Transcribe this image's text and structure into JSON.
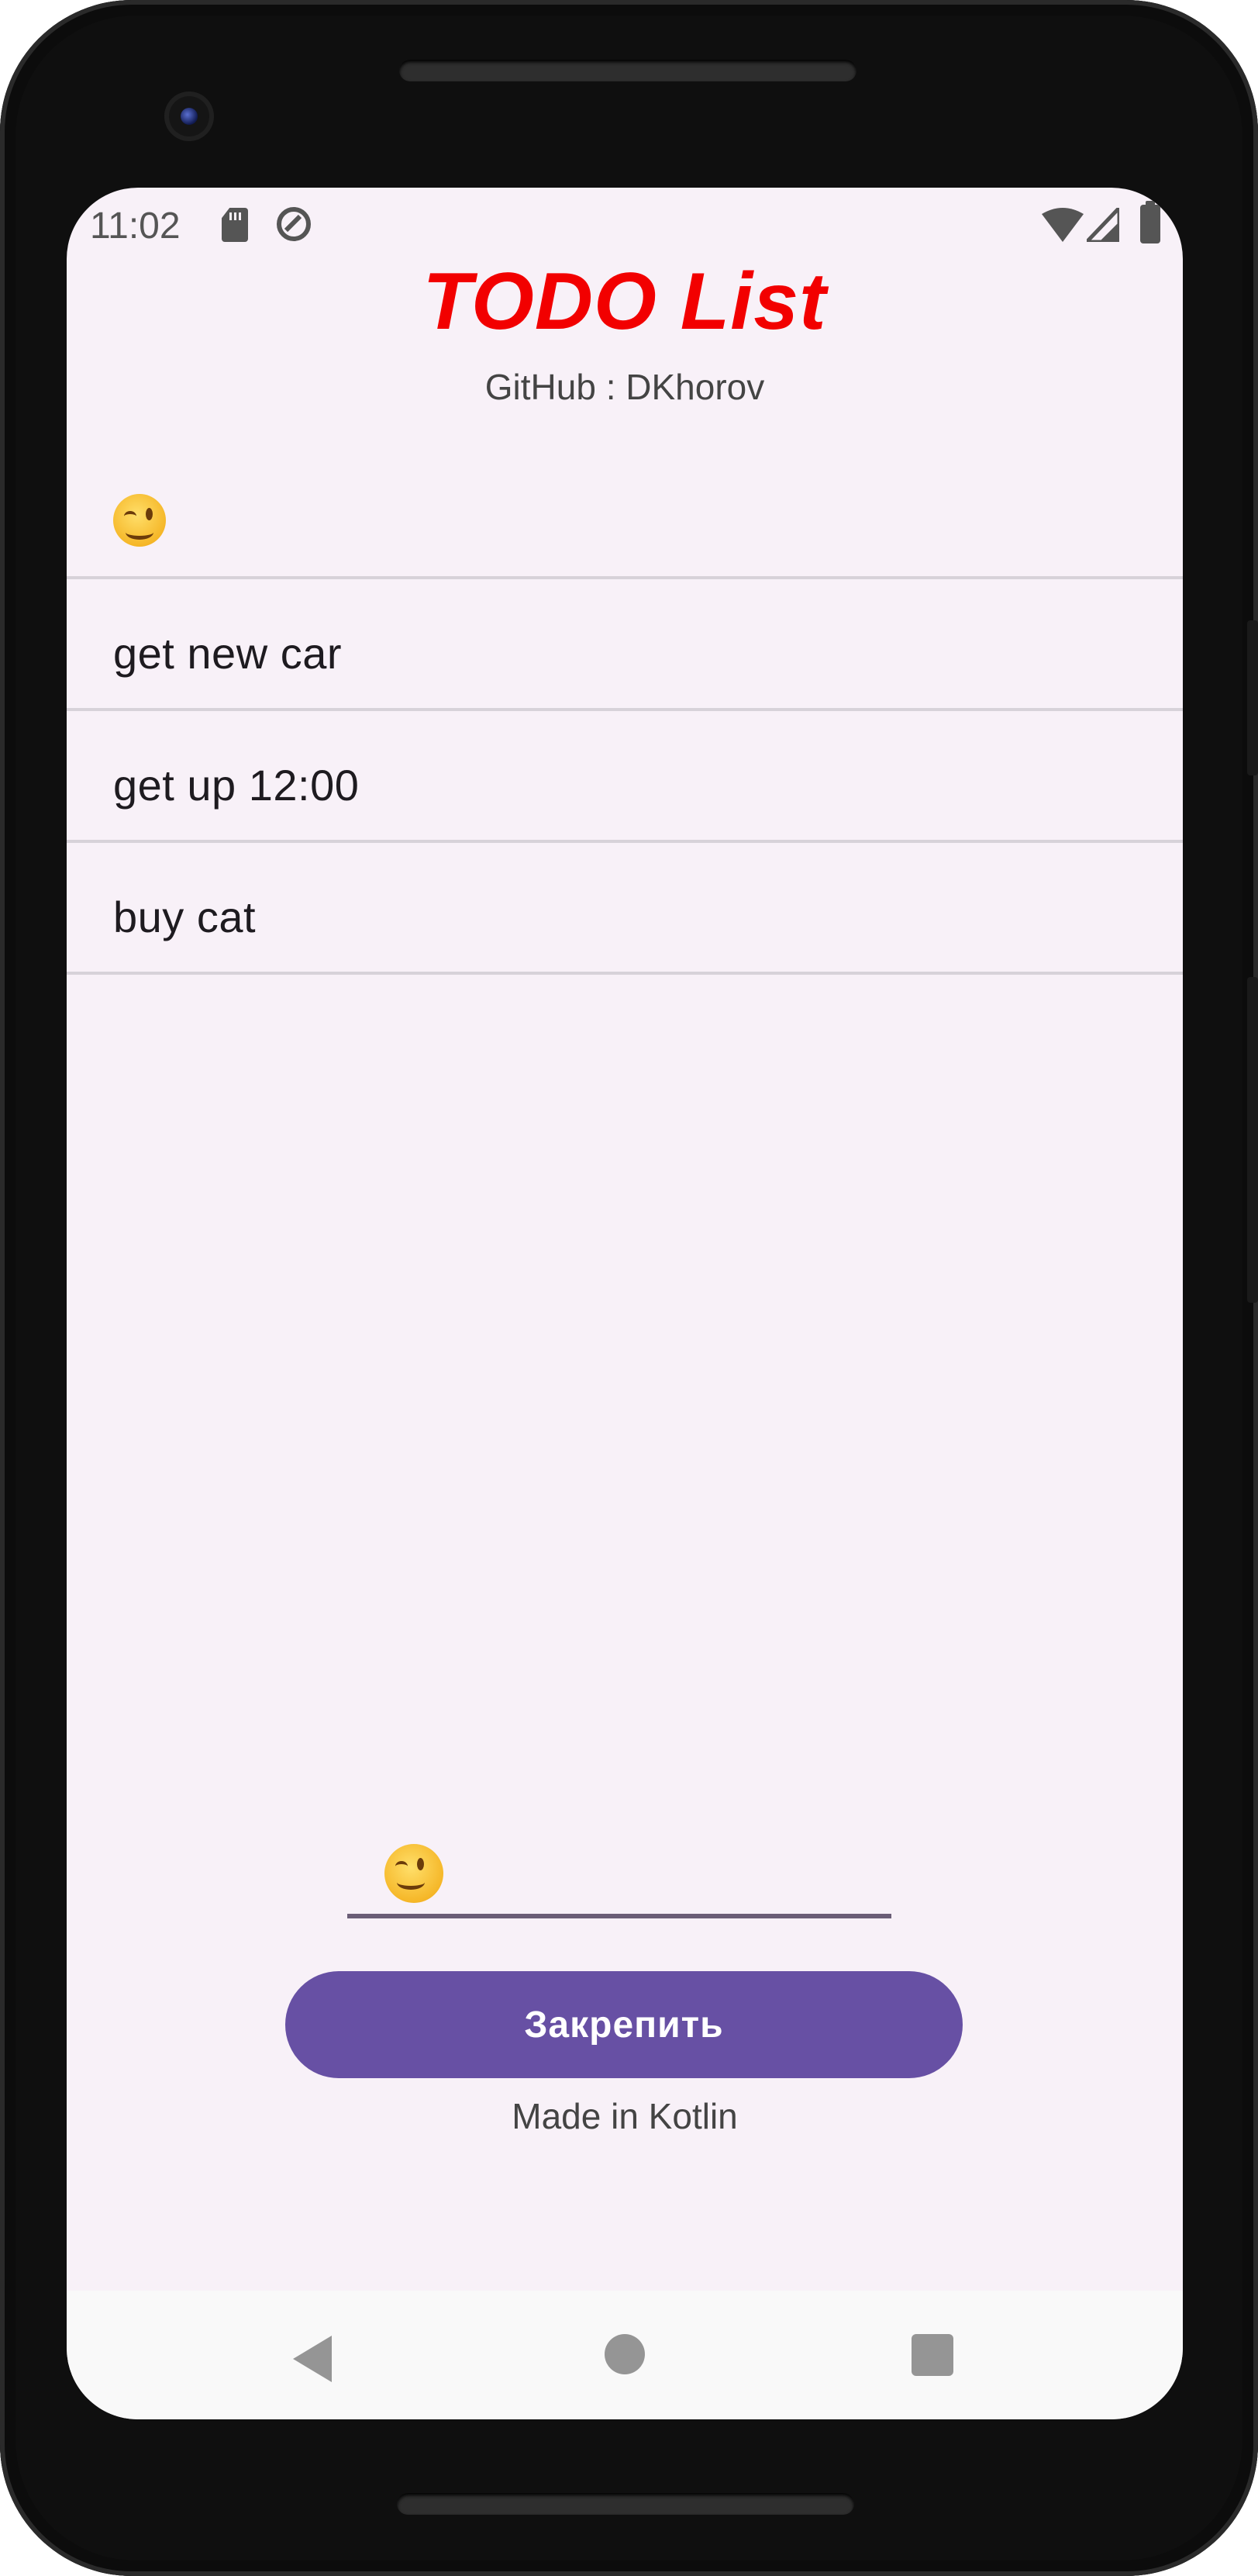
{
  "status_bar": {
    "time": "11:02",
    "icons": [
      "sd-card-icon",
      "sync-icon",
      "wifi-icon",
      "signal-icon",
      "battery-icon"
    ]
  },
  "header": {
    "title": "TODO List",
    "subtitle": "GitHub : DKhorov",
    "title_color": "#f20000"
  },
  "todo_list": {
    "items": [
      {
        "label": "",
        "icon": "winking-face-emoji"
      },
      {
        "label": "get new car"
      },
      {
        "label": "get up 12:00"
      },
      {
        "label": "buy cat"
      }
    ]
  },
  "input": {
    "value": "",
    "icon": "winking-face-emoji"
  },
  "pin_button": {
    "label": "Закрепить",
    "color": "#6750a4"
  },
  "footer": {
    "text": "Made in Kotlin"
  },
  "nav_bar": {
    "icons": [
      "back-icon",
      "home-icon",
      "recents-icon"
    ]
  }
}
